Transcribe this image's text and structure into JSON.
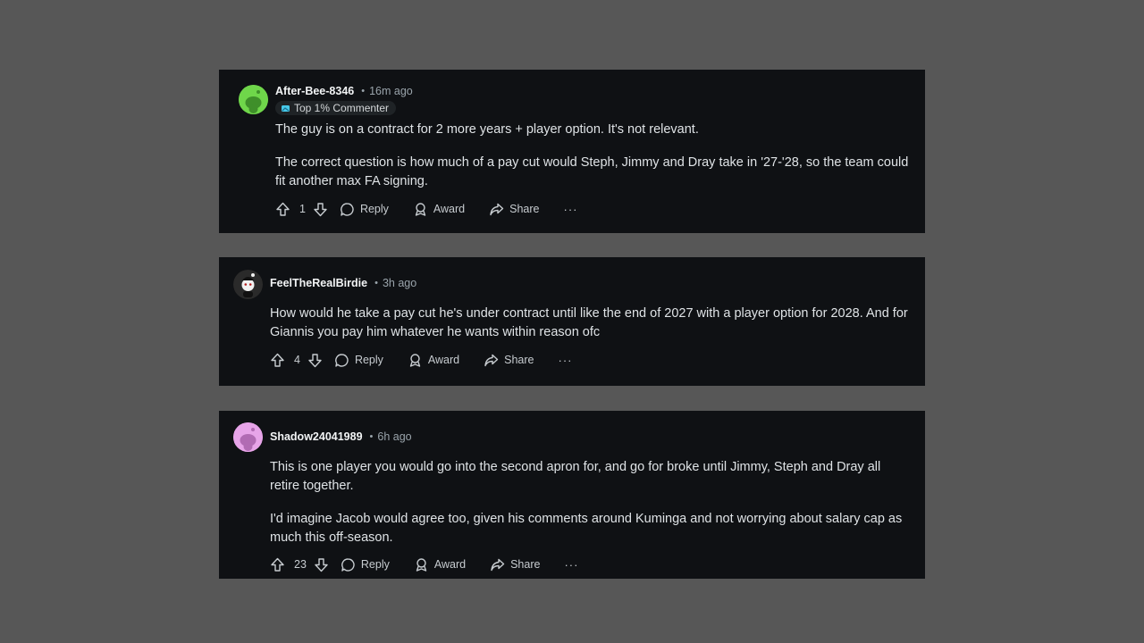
{
  "comments": [
    {
      "username": "After-Bee-8346",
      "time": "16m ago",
      "flair": "Top 1% Commenter",
      "avatar_color": "#6fd64a",
      "paragraphs": [
        "The guy is on a contract for 2 more years + player option. It's not relevant.",
        "The correct question is how much of a pay cut would Steph, Jimmy and Dray take in '27-'28, so the team could fit another max FA signing."
      ],
      "votes": "1",
      "reply_label": "Reply",
      "award_label": "Award",
      "share_label": "Share",
      "more_label": "···"
    },
    {
      "username": "FeelTheRealBirdie",
      "time": "3h ago",
      "avatar_color": "#2b2b2b",
      "paragraphs": [
        "How would he take a pay cut he's under contract until like the end of 2027 with a player option for 2028. And for Giannis you pay him whatever he wants within reason ofc"
      ],
      "votes": "4",
      "reply_label": "Reply",
      "award_label": "Award",
      "share_label": "Share",
      "more_label": "···"
    },
    {
      "username": "Shadow24041989",
      "time": "6h ago",
      "avatar_color": "#e7a4e8",
      "paragraphs": [
        "This is one player you would go into the second apron for, and go for broke until Jimmy, Steph and Dray all retire together.",
        "I'd imagine Jacob would agree too, given his comments around Kuminga and not worrying about salary cap as much this off-season."
      ],
      "votes": "23",
      "reply_label": "Reply",
      "award_label": "Award",
      "share_label": "Share",
      "more_label": "···"
    }
  ]
}
